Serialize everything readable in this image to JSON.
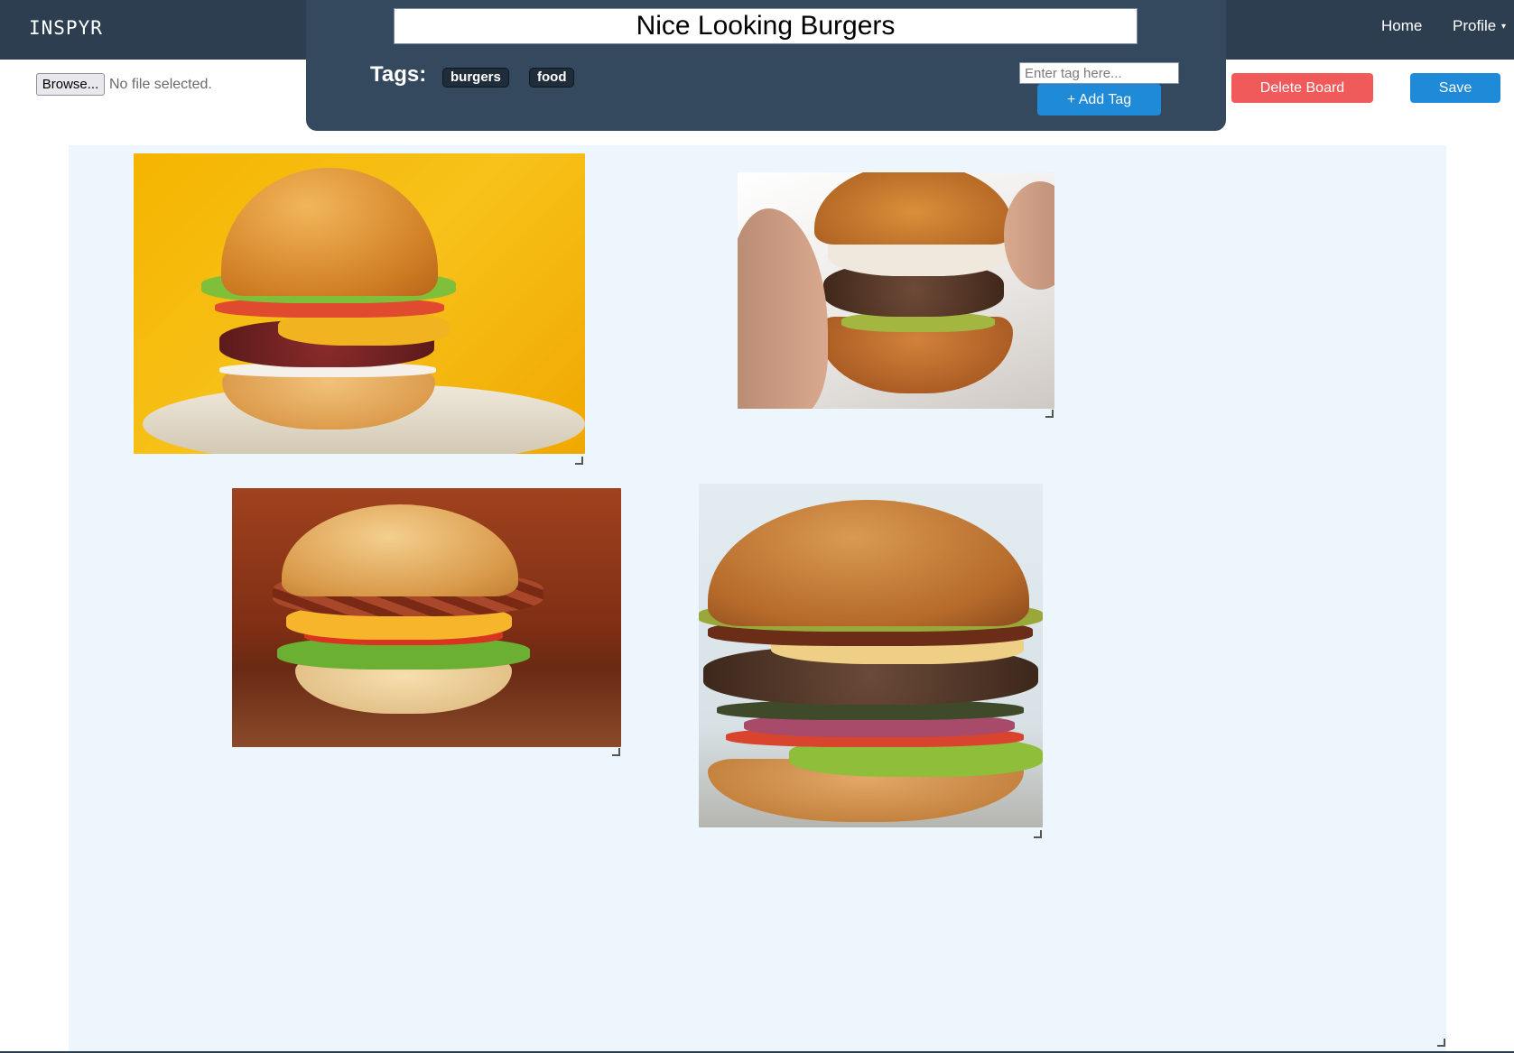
{
  "app": {
    "brand": "INSPYR"
  },
  "nav": {
    "home": "Home",
    "profile": "Profile",
    "caret": "▾"
  },
  "board": {
    "title": "Nice Looking Burgers",
    "tags_label": "Tags:",
    "tags": [
      "burgers",
      "food"
    ],
    "tag_input_placeholder": "Enter tag here...",
    "add_tag_label": "+ Add Tag"
  },
  "file_picker": {
    "browse_label": "Browse...",
    "status": "No file selected."
  },
  "actions": {
    "delete_label": "Delete Board",
    "save_label": "Save"
  },
  "colors": {
    "navbar": "#2d3e50",
    "title_panel": "#34495e",
    "board_bg": "#eef6fd",
    "primary": "#1f8ad8",
    "danger": "#f05a5a"
  }
}
